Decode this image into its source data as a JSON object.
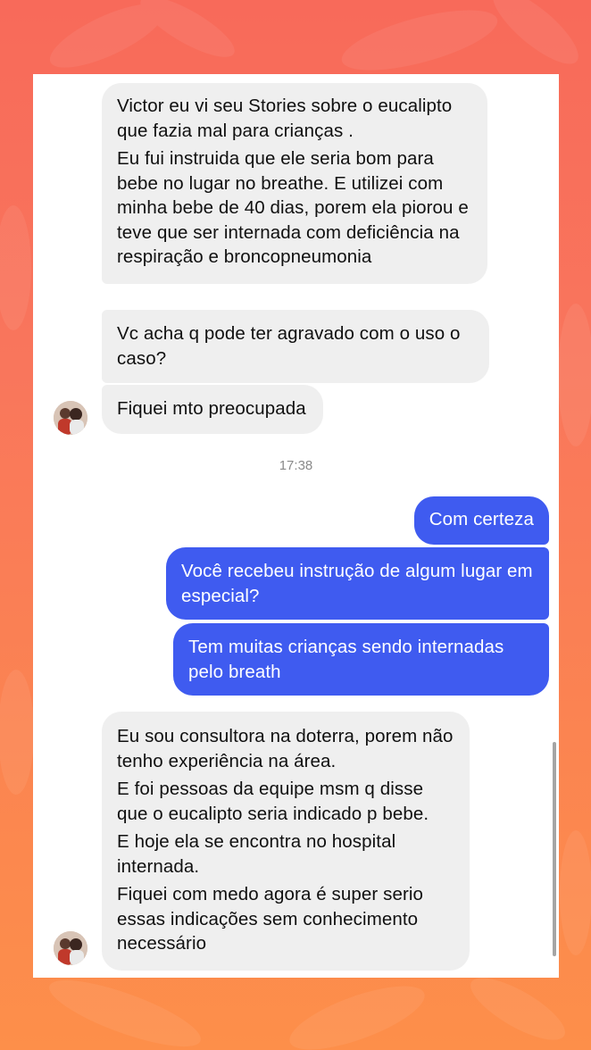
{
  "chat": {
    "messages": [
      {
        "lines": [
          "Victor eu vi seu Stories sobre o eucalipto que fazia mal para crianças .",
          "Eu fui instruida que ele seria bom para bebe no lugar no breathe. E utilizei com minha bebe de 40 dias, porem ela piorou e teve que ser internada com deficiência na respiração e broncopneumonia"
        ]
      },
      {
        "lines": [
          "Vc acha q pode ter agravado com o uso o caso?"
        ]
      },
      {
        "lines": [
          "Fiquei mto preocupada"
        ]
      },
      {
        "lines": [
          "Com certeza"
        ]
      },
      {
        "lines": [
          "Você recebeu instrução de algum lugar em especial?"
        ]
      },
      {
        "lines": [
          "Tem muitas crianças sendo internadas pelo breath"
        ]
      },
      {
        "lines": [
          "Eu sou consultora na doterra, porem não tenho experiência na área.",
          "E foi pessoas da equipe msm q disse que o eucalipto seria indicado p bebe.",
          "E hoje ela se encontra no hospital internada.",
          "Fiquei com medo agora é super serio essas indicações sem conhecimento necessário"
        ]
      }
    ],
    "timestamp": "17:38"
  },
  "colors": {
    "incoming_bubble": "#efefef",
    "outgoing_bubble": "#3f5bf0",
    "background_top": "#f86a5a",
    "background_bottom": "#fd8f4a"
  },
  "icons": {
    "avatar": "contact-avatar-photo"
  }
}
